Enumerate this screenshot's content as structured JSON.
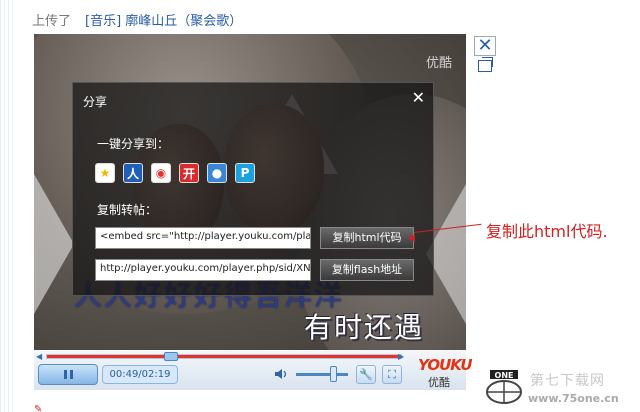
{
  "header": {
    "prefix": "上传了",
    "link_text": "[音乐] 廓峰山丘（聚会歌）"
  },
  "player": {
    "watermark": "优酷",
    "lyrics_bg": "人人好好好得吾洋洋",
    "lyrics": "有时还遇",
    "share_panel": {
      "title": "分享",
      "one_click_label": "一键分享到：",
      "copy_repost_label": "复制转帖：",
      "share_icons": [
        "qzone-icon",
        "renren-icon",
        "weibo-icon",
        "kaixin-icon",
        "qq-icon",
        "pengyou-icon"
      ],
      "html_code": "<embed src=\"http://player.youku.com/player.php/sid/XN",
      "flash_url": "http://player.youku.com/player.php/sid/XN",
      "copy_html_label": "复制html代码",
      "copy_flash_label": "复制flash地址"
    },
    "controls": {
      "time": "00:49/02:19",
      "progress_fraction": 0.35,
      "volume_fraction": 0.7,
      "logo": "YOUKU",
      "logo_cn": "优酷"
    }
  },
  "annotation": "复制此html代码.",
  "site_mark": {
    "name": "第七下载网",
    "url": "www.75one.cn"
  },
  "colors": {
    "accent_red": "#d81e1e",
    "link_blue": "#2a5caa",
    "progress_red": "#e0342f"
  }
}
